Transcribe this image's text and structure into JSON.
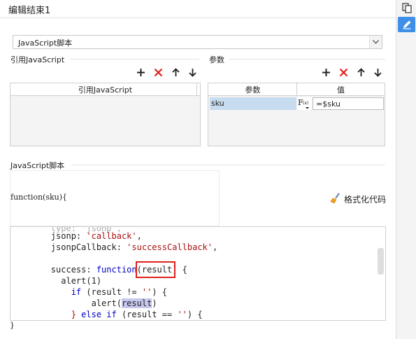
{
  "dialog": {
    "title": "编辑结束1"
  },
  "script_type": {
    "selected": "JavaScript脚本"
  },
  "ref_js": {
    "section_label": "引用JavaScript",
    "column_header": "引用JavaScript"
  },
  "params": {
    "section_label": "参数",
    "col_param": "参数",
    "col_value": "值",
    "rows": [
      {
        "name": "sku",
        "value": "=$sku"
      }
    ]
  },
  "script": {
    "section_label": "JavaScript脚本",
    "function_signature": "function(sku){",
    "format_label": "格式化代码",
    "closing": "}",
    "code_lines": [
      "        jsonp: 'callback',",
      "        jsonpCallback: 'successCallback',",
      "",
      "        success: function(result) {",
      "          alert(1)",
      "            if (result != '') {",
      "                alert(result)",
      "            } else if (result == '') {"
    ]
  },
  "icons": [
    "copy-icon",
    "edit-icon",
    "add-icon",
    "delete-icon",
    "move-up-icon",
    "move-down-icon",
    "dropdown-arrow-icon",
    "formula-icon",
    "broom-icon"
  ],
  "colors": {
    "accent": "#3f8ee8",
    "delete": "#e0201b",
    "selected_row": "#c8dcf0",
    "highlight_box": "#e0201b"
  }
}
